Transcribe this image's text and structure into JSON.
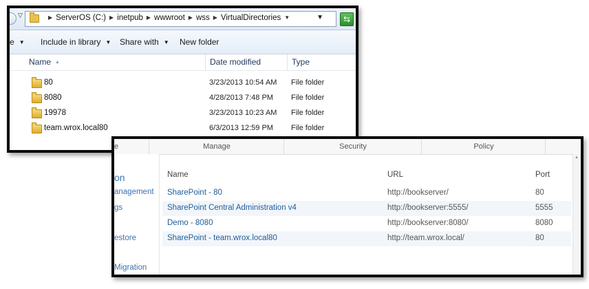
{
  "explorer": {
    "breadcrumb": [
      "ServerOS (C:)",
      "inetpub",
      "wwwroot",
      "wss",
      "VirtualDirectories"
    ],
    "toolbar": {
      "cut_left": "e",
      "include_in_library": "Include in library",
      "share_with": "Share with",
      "new_folder": "New folder"
    },
    "columns": {
      "name": "Name",
      "date_modified": "Date modified",
      "type": "Type"
    },
    "files": [
      {
        "name": "80",
        "date": "3/23/2013 10:54 AM",
        "type": "File folder"
      },
      {
        "name": "8080",
        "date": "4/28/2013 7:48 PM",
        "type": "File folder"
      },
      {
        "name": "19978",
        "date": "3/23/2013 10:23 AM",
        "type": "File folder"
      },
      {
        "name": "team.wrox.local80",
        "date": "6/3/2013 12:59 PM",
        "type": "File folder"
      }
    ]
  },
  "sharepoint": {
    "ribbon_groups": [
      "e",
      "Manage",
      "Security",
      "Policy"
    ],
    "quicklaunch": {
      "heading": "on",
      "items": [
        "anagement",
        "gs",
        "estore",
        "Migration"
      ]
    },
    "table": {
      "headers": {
        "name": "Name",
        "url": "URL",
        "port": "Port"
      },
      "rows": [
        {
          "name": "SharePoint - 80",
          "url": "http://bookserver/",
          "port": "80"
        },
        {
          "name": "SharePoint Central Administration v4",
          "url": "http://bookserver:5555/",
          "port": "5555"
        },
        {
          "name": "Demo - 8080",
          "url": "http://bookserver:8080/",
          "port": "8080"
        },
        {
          "name": "SharePoint - team.wrox.local80",
          "url": "http://team.wrox.local/",
          "port": "80"
        }
      ]
    }
  }
}
